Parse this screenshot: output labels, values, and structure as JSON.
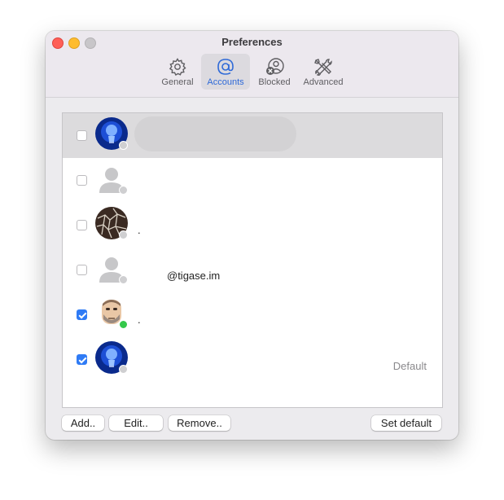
{
  "window": {
    "title": "Preferences"
  },
  "toolbar": {
    "tabs": [
      {
        "label": "General",
        "icon": "gear-icon"
      },
      {
        "label": "Accounts",
        "icon": "at-sign-icon",
        "active": true
      },
      {
        "label": "Blocked",
        "icon": "blocked-user-icon"
      },
      {
        "label": "Advanced",
        "icon": "tools-icon"
      }
    ]
  },
  "accounts": [
    {
      "enabled": false,
      "avatar": "lightbulb-avatar",
      "status": "offline",
      "text": "",
      "selected": true
    },
    {
      "enabled": false,
      "avatar": "default-person-avatar",
      "status": "offline",
      "text": ""
    },
    {
      "enabled": false,
      "avatar": "cracked-pattern-avatar",
      "status": "offline",
      "text": "."
    },
    {
      "enabled": false,
      "avatar": "default-person-avatar",
      "status": "offline",
      "text": "@tigase.im"
    },
    {
      "enabled": true,
      "avatar": "memoji-avatar",
      "status": "online",
      "text": "."
    },
    {
      "enabled": true,
      "avatar": "lightbulb-avatar",
      "status": "offline",
      "text": "",
      "default_label": "Default"
    }
  ],
  "buttons": {
    "add": "Add..",
    "edit": "Edit..",
    "remove": "Remove..",
    "set_default": "Set default"
  },
  "colors": {
    "accent": "#2f7bf5",
    "online": "#34c84a",
    "offline": "#cfcfd1"
  }
}
